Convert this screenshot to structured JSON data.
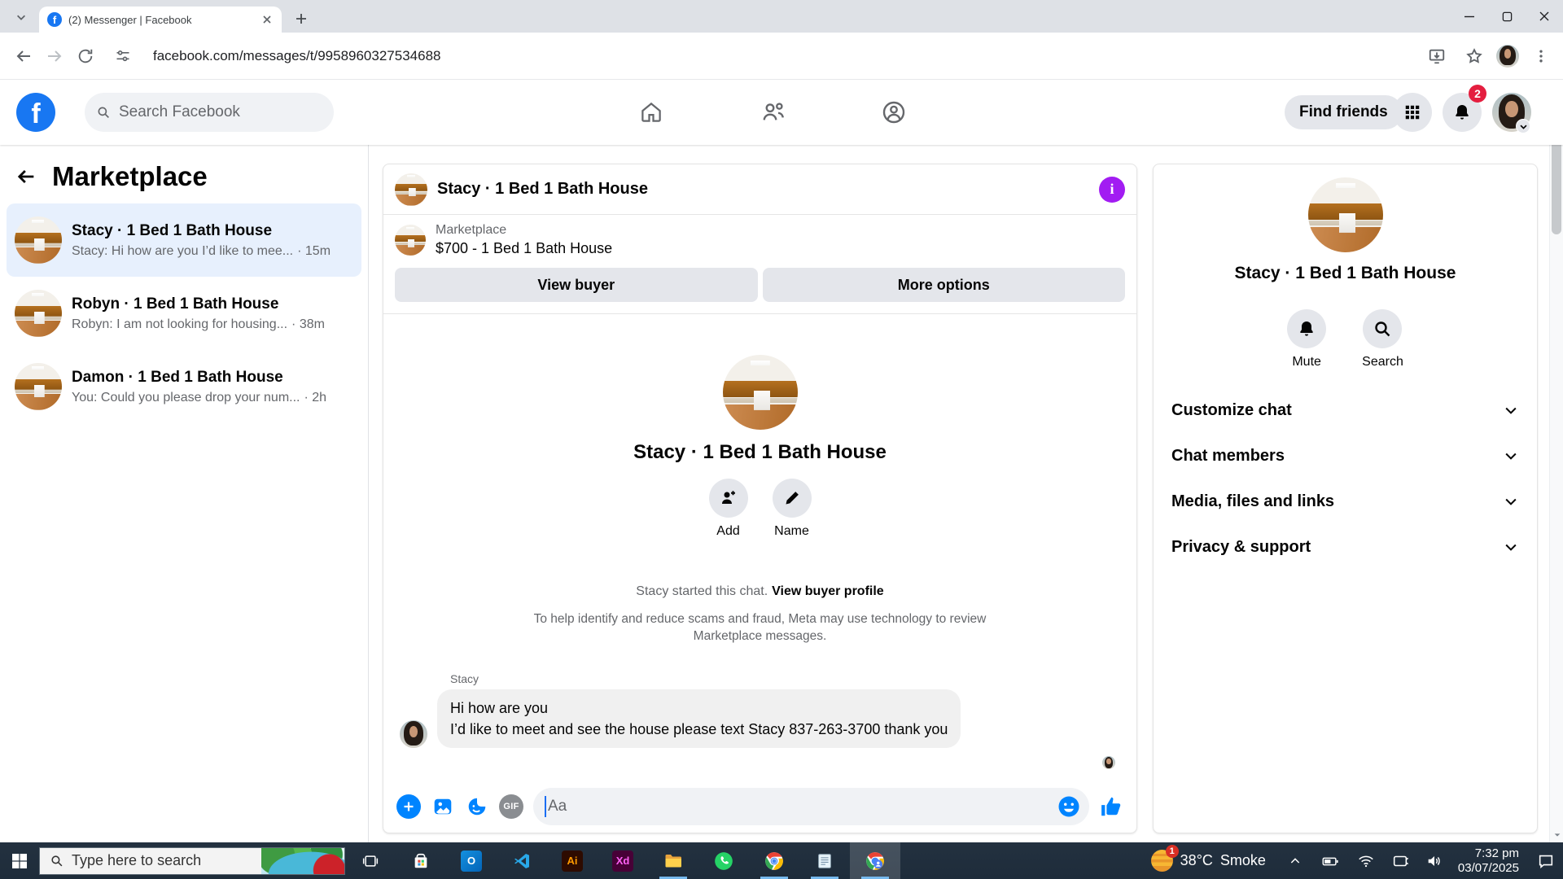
{
  "browser": {
    "tab_title": "(2) Messenger | Facebook",
    "url": "facebook.com/messages/t/9958960327534688"
  },
  "fb_header": {
    "search_placeholder": "Search Facebook",
    "find_friends": "Find friends",
    "notification_count": "2"
  },
  "sidebar": {
    "title": "Marketplace",
    "conversations": [
      {
        "title": "Stacy · 1 Bed 1 Bath House",
        "preview": "Stacy: Hi how are you I’d like to mee...",
        "time": "· 15m"
      },
      {
        "title": "Robyn · 1 Bed 1 Bath House",
        "preview": "Robyn: I am not looking for housing...",
        "time": "· 38m"
      },
      {
        "title": "Damon · 1 Bed 1 Bath House",
        "preview": "You: Could you please drop your num...",
        "time": "· 2h"
      }
    ]
  },
  "chat": {
    "title": "Stacy · 1 Bed 1 Bath House",
    "info_glyph": "i",
    "marketplace_label": "Marketplace",
    "listing_title": "$700 - 1 Bed 1 Bath House",
    "view_buyer": "View buyer",
    "more_options": "More options",
    "profile_title": "Stacy · 1 Bed 1 Bath House",
    "add_label": "Add",
    "name_label": "Name",
    "started_text": "Stacy started this chat.",
    "view_buyer_profile": "View buyer profile",
    "disclaimer": "To help identify and reduce scams and fraud, Meta may use technology to review Marketplace messages.",
    "sender_name": "Stacy",
    "message_line1": "Hi how are you",
    "message_line2": "I’d like to meet and see the house please text Stacy 837-263-3700 thank you",
    "composer_placeholder": "Aa",
    "gif_label": "GIF"
  },
  "details": {
    "title": "Stacy · 1 Bed 1 Bath House",
    "mute_label": "Mute",
    "search_label": "Search",
    "sections": [
      {
        "label": "Customize chat"
      },
      {
        "label": "Chat members"
      },
      {
        "label": "Media, files and links"
      },
      {
        "label": "Privacy & support"
      }
    ]
  },
  "taskbar": {
    "search_placeholder": "Type here to search",
    "temperature": "38°C",
    "condition": "Smoke",
    "weather_badge": "1",
    "time": "7:32 pm",
    "date": "03/07/2025",
    "ai_label": "Ai",
    "xd_label": "Xd",
    "outlook_label": "O"
  },
  "colors": {
    "fb_blue": "#1877f2",
    "messenger_blue": "#0084ff",
    "info_purple": "#a21cf2",
    "badge_red": "#e41e3f",
    "selected_conversation_bg": "#e7f0fd",
    "bubble_gray": "#f0f0f0"
  }
}
